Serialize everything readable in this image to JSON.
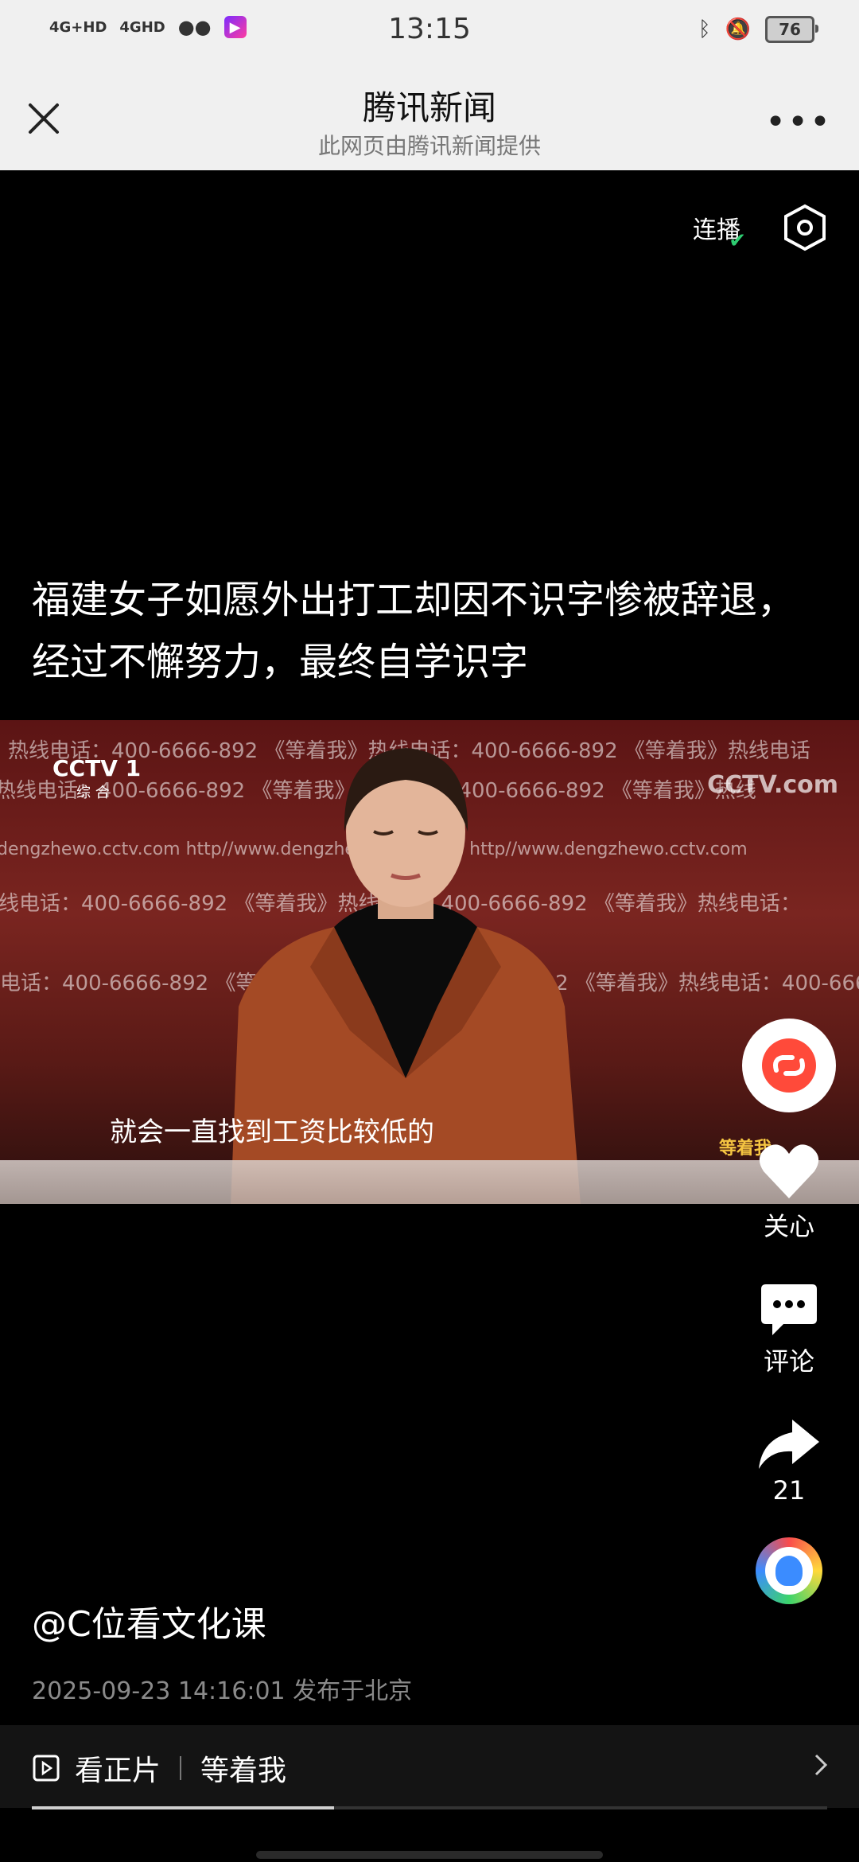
{
  "status_bar": {
    "time": "13:15",
    "net1": "4G+HD",
    "net2": "4GHD",
    "battery": "76"
  },
  "header": {
    "title": "腾讯新闻",
    "subtitle": "此网页由腾讯新闻提供"
  },
  "player_top": {
    "lianbo_label": "连播"
  },
  "content": {
    "caption": "福建女子如愿外出打工却因不识字惨被辞退，经过不懈努力，最终自学识字",
    "video_subtitle": "就会一直找到工资比较低的",
    "cctv_channel": "CCTV 1",
    "cctv_sub": "综 合",
    "cctv_com": "CCTV.com",
    "program_logo": "等着我",
    "bg_lines": [
      "热线电话：400-6666-892  《等着我》热线电话：400-6666-892  《等着我》热线电话",
      "热线电话：400-6666-892   《等着我》热线电话：400-6666-892   《等着我》热线",
      "dengzhewo.cctv.com    http//www.dengzhewo.cctv.com    http//www.dengzhewo.cctv.com",
      "线电话：400-6666-892   《等着我》热线电话：400-6666-892   《等着我》热线电话：",
      "电话：400-6666-892   《等着我》热线电话：400-6666-892   《等着我》热线电话：400-6666"
    ]
  },
  "actions": {
    "like_label": "关心",
    "comment_label": "评论",
    "share_count": "21"
  },
  "post": {
    "author": "@C位看文化课",
    "meta": "2025-09-23 14:16:01 发布于北京"
  },
  "bottom_bar": {
    "watch_label": "看正片",
    "program": "等着我"
  },
  "progress": {
    "fraction": 0.38
  }
}
